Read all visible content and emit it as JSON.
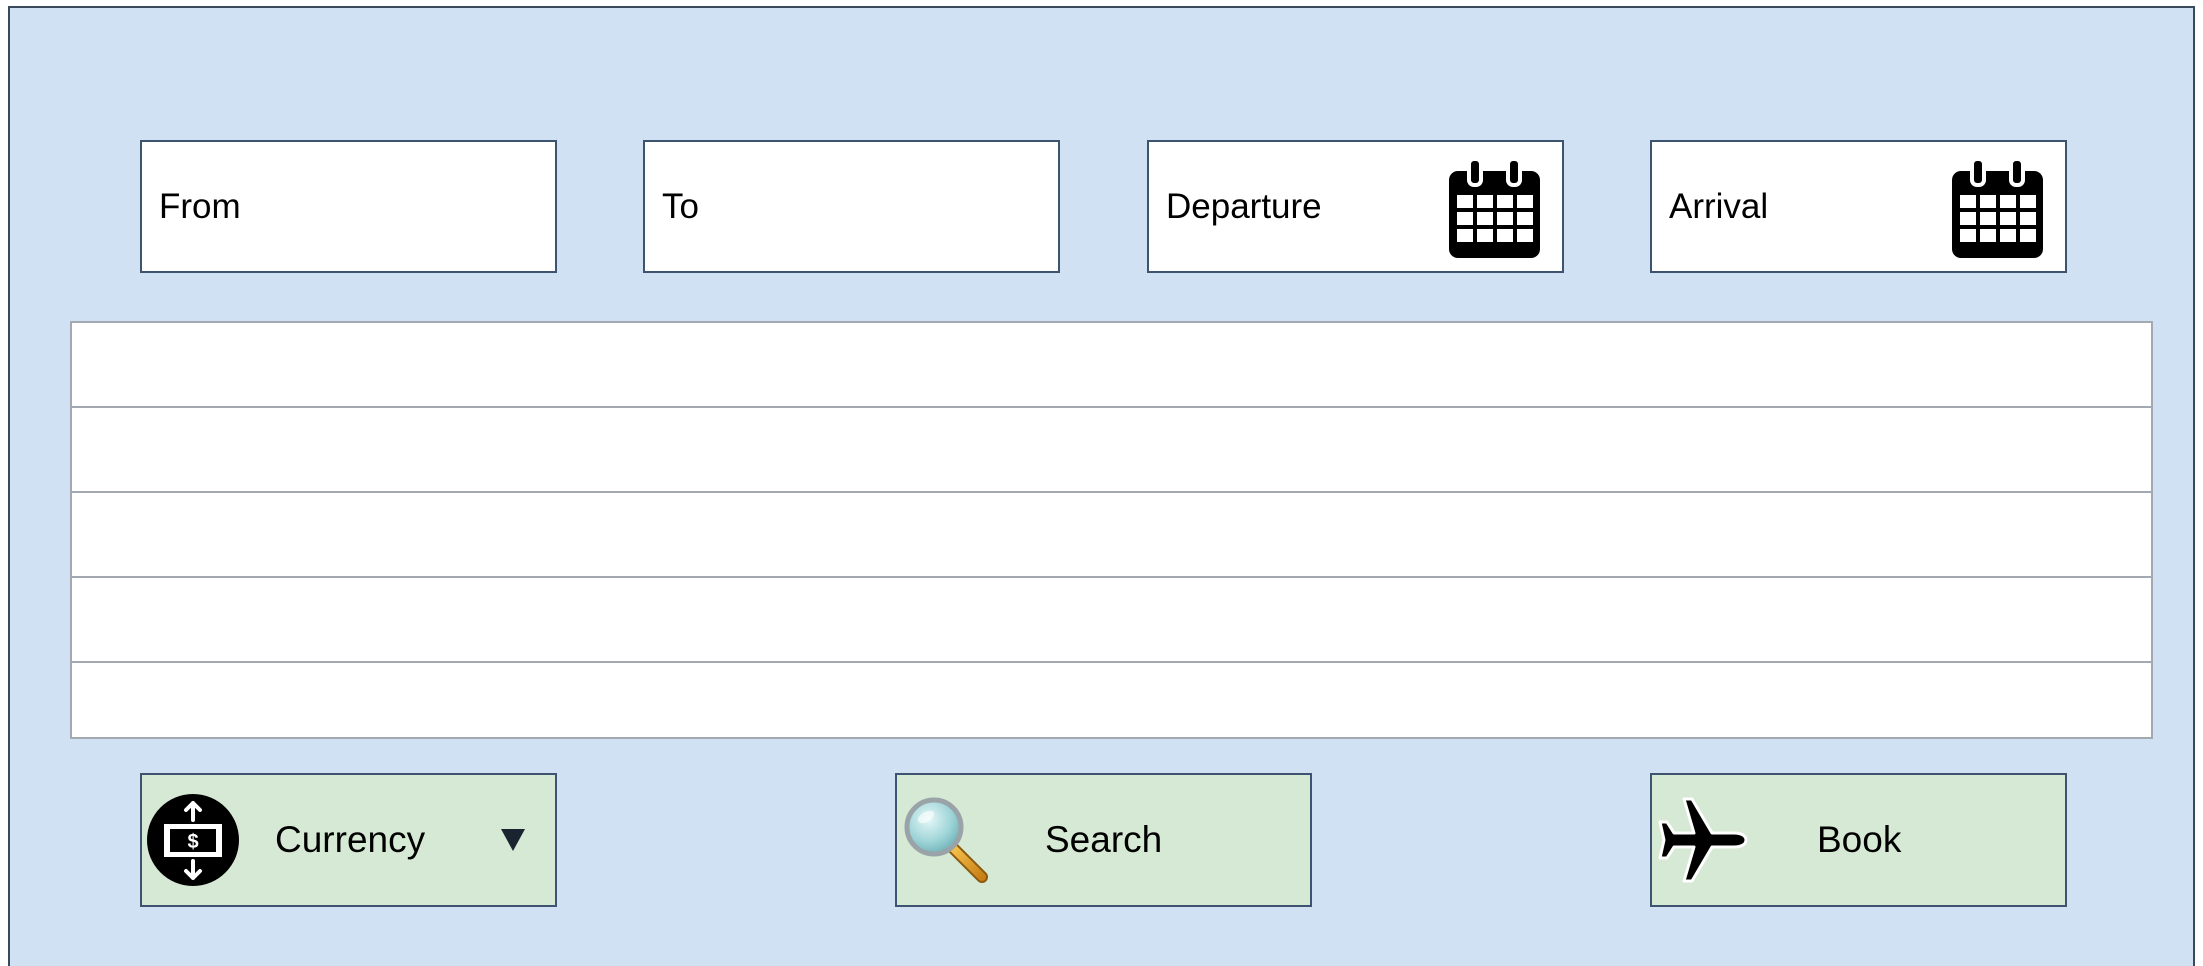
{
  "form": {
    "from_label": "From",
    "to_label": "To",
    "departure_label": "Departure",
    "arrival_label": "Arrival"
  },
  "results": {
    "rows": [
      "",
      "",
      "",
      "",
      ""
    ]
  },
  "actions": {
    "currency_label": "Currency",
    "search_label": "Search",
    "book_label": "Book"
  },
  "icons": {
    "departure": "calendar-icon",
    "arrival": "calendar-icon",
    "currency": "currency-exchange-icon",
    "currency_dropdown": "caret-down-icon",
    "search": "magnifying-glass-icon",
    "book": "airplane-icon"
  },
  "colors": {
    "background": "#cfe1f2",
    "field_bg": "#ffffff",
    "button_bg": "#d6e9d4",
    "border": "#3d5370"
  }
}
